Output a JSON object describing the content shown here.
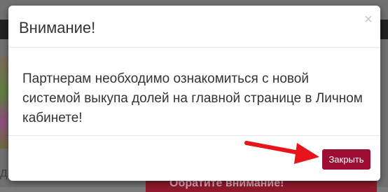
{
  "background": {
    "banner_text": "Обратите внимание!",
    "left_text_fragment": "ди"
  },
  "modal": {
    "title": "Внимание!",
    "close_symbol": "×",
    "message": "Партнерам необходимо ознакомиться с новой системой выкупа долей на главной странице в Личном кабинете!",
    "button_label": "Закрыть"
  },
  "colors": {
    "button": "#9c0f33",
    "arrow": "#e8141b",
    "overlay": "#707070"
  },
  "icons": {
    "close": "close-icon",
    "annotation": "red-arrow-icon"
  }
}
